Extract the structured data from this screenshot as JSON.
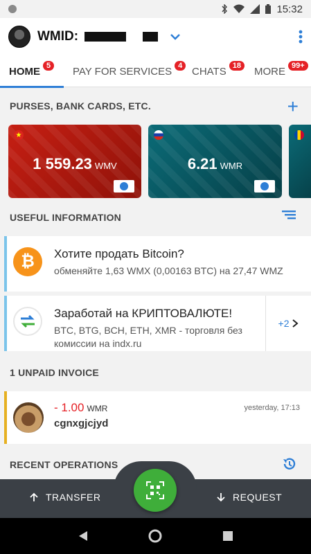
{
  "status_bar": {
    "time": "15:32"
  },
  "header": {
    "wmid_label": "WMID:"
  },
  "tabs": [
    {
      "label": "HOME",
      "badge": "5"
    },
    {
      "label": "PAY FOR SERVICES",
      "badge": "4"
    },
    {
      "label": "CHATS",
      "badge": "18"
    },
    {
      "label": "MORE",
      "badge": "99+"
    }
  ],
  "purses": {
    "title": "PURSES, BANK CARDS, ETC.",
    "cards": [
      {
        "amount": "1 559.23",
        "currency": "WMV",
        "flag": "vietnam",
        "color": "#c61f13"
      },
      {
        "amount": "6.21",
        "currency": "WMR",
        "flag": "russia",
        "color": "#0b6b77"
      },
      {
        "amount": "",
        "currency": "",
        "flag": "moldova",
        "color": "#0b6b77"
      }
    ]
  },
  "useful": {
    "title": "USEFUL INFORMATION",
    "items": [
      {
        "title": "Хотите продать Bitcoin?",
        "desc": "обменяйте 1,63 WMX (0,00163 BTC) на 27,47 WMZ",
        "icon": "bitcoin-icon"
      },
      {
        "title": "Заработай на КРИПТОВАЛЮТЕ!",
        "desc": "BTC, BTG, BCH, ETH, XMR - торговля без комиссии на indx.ru",
        "icon": "exchange-icon",
        "more": "+2"
      }
    ]
  },
  "invoice": {
    "title": "1 UNPAID INVOICE",
    "amount": "- 1.00",
    "currency": "WMR",
    "from": "cgnxgjcjyd",
    "time": "yesterday, 17:13"
  },
  "recent": {
    "title": "RECENT OPERATIONS"
  },
  "actions": {
    "transfer": "TRANSFER",
    "request": "REQUEST"
  },
  "colors": {
    "accent": "#2d7ed6",
    "badge": "#e52126",
    "fab": "#3fae3a",
    "bar": "#3b4046"
  }
}
